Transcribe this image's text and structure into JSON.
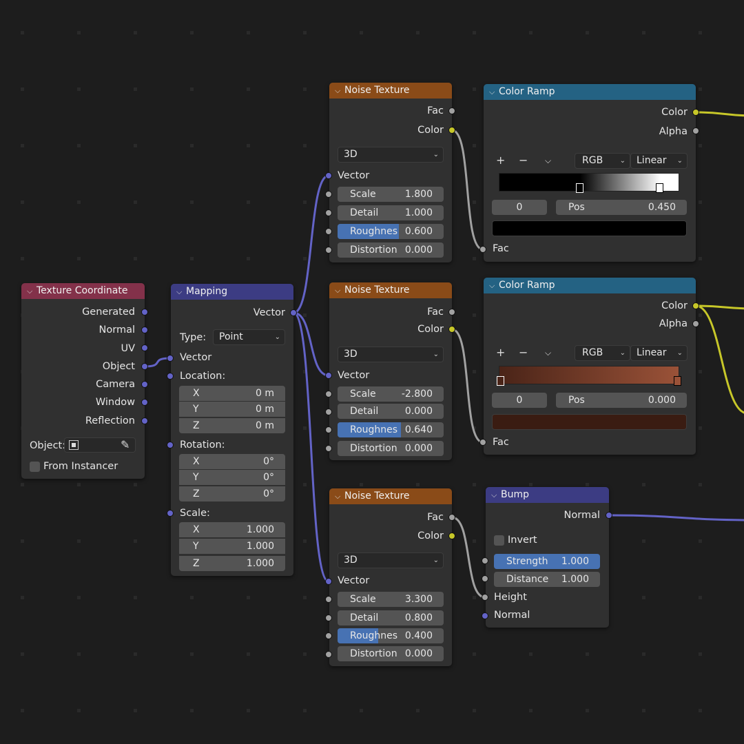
{
  "colors": {
    "input": "#83314a",
    "vector": "#3c3c83",
    "texture": "#8a4b18",
    "converter": "#246283",
    "socket_vector": "#6363c7",
    "socket_float": "#a1a1a1",
    "socket_color": "#c7c729",
    "field": "#545454",
    "slider_fill": "#4772b3"
  },
  "texcoord": {
    "title": "Texture Coordinate",
    "outputs": [
      "Generated",
      "Normal",
      "UV",
      "Object",
      "Camera",
      "Window",
      "Reflection"
    ],
    "object_label": "Object:",
    "from_instancer": "From Instancer"
  },
  "mapping": {
    "title": "Mapping",
    "out_vector": "Vector",
    "type_label": "Type:",
    "type_value": "Point",
    "in_vector": "Vector",
    "location_label": "Location:",
    "location": {
      "x": "0 m",
      "y": "0 m",
      "z": "0 m"
    },
    "rotation_label": "Rotation:",
    "rotation": {
      "x": "0°",
      "y": "0°",
      "z": "0°"
    },
    "scale_label": "Scale:",
    "scale": {
      "x": "1.000",
      "y": "1.000",
      "z": "1.000"
    },
    "axis": {
      "x": "X",
      "y": "Y",
      "z": "Z"
    }
  },
  "noise_common": {
    "title": "Noise Texture",
    "fac": "Fac",
    "color": "Color",
    "dims": "3D",
    "vector": "Vector",
    "scale_label": "Scale",
    "detail_label": "Detail",
    "rough_label": "Roughnes",
    "dist_label": "Distortion"
  },
  "noise1": {
    "scale": "1.800",
    "detail": "1.000",
    "roughness": "0.600",
    "roughness_fraction": 0.6,
    "distortion": "0.000"
  },
  "noise2": {
    "scale": "-2.800",
    "detail": "0.000",
    "roughness": "0.640",
    "roughness_fraction": 0.64,
    "distortion": "0.000"
  },
  "noise3": {
    "scale": "3.300",
    "detail": "0.800",
    "roughness": "0.400",
    "roughness_fraction": 0.4,
    "distortion": "0.000"
  },
  "ramp_common": {
    "title": "Color Ramp",
    "color": "Color",
    "alpha": "Alpha",
    "plus": "+",
    "minus": "−",
    "mode": "RGB",
    "interp": "Linear",
    "pos_label": "Pos",
    "fac": "Fac"
  },
  "ramp1": {
    "index": "0",
    "pos": "0.450",
    "stop_color": "#000000",
    "gradient": [
      "#000000",
      "#000000",
      "#ffffff"
    ]
  },
  "ramp2": {
    "index": "0",
    "pos": "0.000",
    "stop_color": "#3a1c12",
    "gradient": [
      "#4a2418",
      "#9a5238"
    ]
  },
  "bump": {
    "title": "Bump",
    "normal_out": "Normal",
    "invert": "Invert",
    "strength_label": "Strength",
    "strength": "1.000",
    "distance_label": "Distance",
    "distance": "1.000",
    "height": "Height",
    "normal_in": "Normal"
  }
}
